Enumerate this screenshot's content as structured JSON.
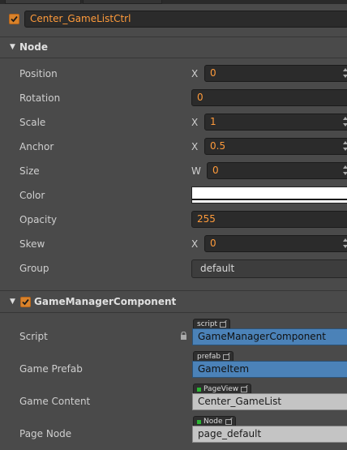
{
  "node_name": "Center_GameListCtrl",
  "node_section": {
    "title": "Node",
    "position": {
      "label": "Position",
      "axis": "X",
      "value": "0"
    },
    "rotation": {
      "label": "Rotation",
      "value": "0"
    },
    "scale": {
      "label": "Scale",
      "axis": "X",
      "value": "1"
    },
    "anchor": {
      "label": "Anchor",
      "axis": "X",
      "value": "0.5"
    },
    "size": {
      "label": "Size",
      "axis": "W",
      "value": "0"
    },
    "color": {
      "label": "Color",
      "value": "#ffffff"
    },
    "opacity": {
      "label": "Opacity",
      "value": "255"
    },
    "skew": {
      "label": "Skew",
      "axis": "X",
      "value": "0"
    },
    "group": {
      "label": "Group",
      "value": "default"
    }
  },
  "component_section": {
    "title": "GameManagerComponent",
    "script": {
      "label": "Script",
      "tag": "script",
      "value": "GameManagerComponent"
    },
    "game_prefab": {
      "label": "Game Prefab",
      "tag": "prefab",
      "value": "GameItem"
    },
    "game_content": {
      "label": "Game Content",
      "tag": "PageView",
      "value": "Center_GameList"
    },
    "page_node": {
      "label": "Page Node",
      "tag": "Node",
      "value": "page_default"
    }
  },
  "colors": {
    "accent": "#d9822b",
    "value_text": "#ff9b3b",
    "ref_blue": "#4b82b8"
  }
}
